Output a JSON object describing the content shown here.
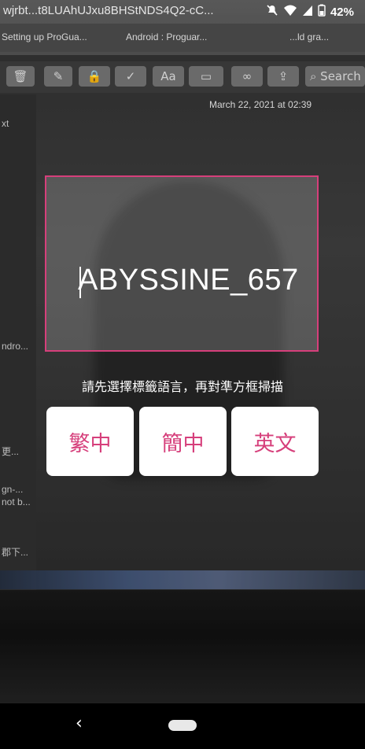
{
  "status_bar": {
    "ticker_text": "wjrbt...t8LUAhUJxu8BHStNDS4Q2-cC...",
    "battery_percent": "42%"
  },
  "background": {
    "tab_left": "Setting up ProGua...",
    "tab_mid": "Android : Proguar...",
    "tab_right": "...ld gra...",
    "date": "March 22, 2021 at 02:39",
    "side_items": [
      "xt",
      "ndro...",
      "更...",
      "gn-...",
      "not b...",
      "郡下..."
    ],
    "search_placeholder": "Search"
  },
  "scanner": {
    "recognized_text": "ABYSSINE_657",
    "prompt": "請先選擇標籤語言，再對準方框掃描",
    "accent_color": "#d63f7b"
  },
  "language_buttons": [
    {
      "label": "繁中"
    },
    {
      "label": "簡中"
    },
    {
      "label": "英文"
    }
  ],
  "nav": {
    "back_icon": "chevron-left-icon",
    "home_icon": "home-pill-icon"
  }
}
